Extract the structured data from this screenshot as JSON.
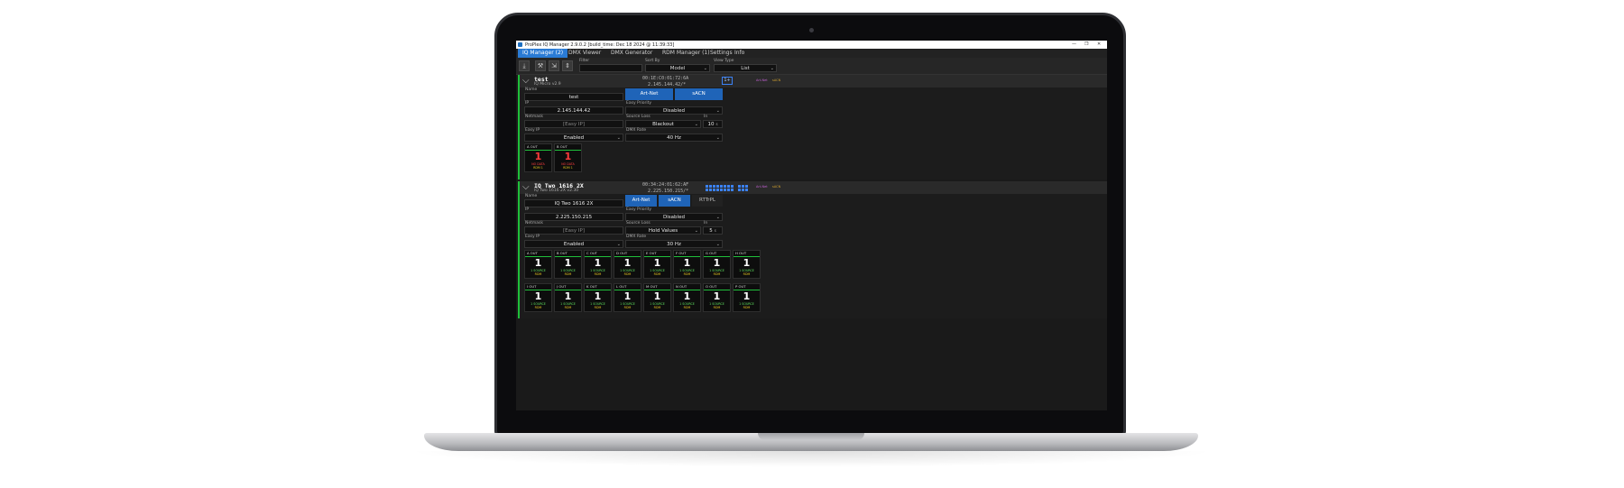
{
  "window": {
    "title": "ProPlex IQ Manager 2.9.0.2 [build_time: Dec 18 2024 @ 11:39:33]",
    "minimize": "—",
    "maximize": "❐",
    "close": "✕"
  },
  "menu": {
    "items": [
      "IQ Manager (2)",
      "DMX Viewer",
      "DMX Generator",
      "RDM Manager (1)",
      "Settings",
      "Info"
    ],
    "active_index": 0
  },
  "toolbar": {
    "icons": [
      "download-icon",
      "wrench-icon",
      "collapse-icon",
      "expand-icon"
    ],
    "filter": {
      "label": "Filter",
      "value": ""
    },
    "sort_by": {
      "label": "Sort By",
      "value": "Model"
    },
    "view_type": {
      "label": "View Type",
      "value": "List"
    }
  },
  "devices": [
    {
      "name": "test",
      "subtitle": "IQ Micro v2.9",
      "mac": "00:1E:C0:01:72:6A",
      "ip_display": "2.145.144.42/*",
      "badge": "1+",
      "proto_tags": [
        "Art-Net",
        "sACN"
      ],
      "fields": {
        "name": {
          "label": "Name",
          "value": "test"
        },
        "ip": {
          "label": "IP",
          "value": "2.145.144.42"
        },
        "netmask": {
          "label": "Netmask",
          "value": "[Easy IP]"
        },
        "easy_ip": {
          "label": "Easy IP",
          "value": "Enabled"
        },
        "easy_priority": {
          "label": "Easy Priority",
          "value": "Disabled"
        },
        "source_loss": {
          "label": "Source Loss",
          "value": "Blackout"
        },
        "in": {
          "label": "In",
          "value": "10",
          "unit": "s"
        },
        "dmx_rate": {
          "label": "DMX Rate",
          "value": "40 Hz"
        }
      },
      "protocols": [
        "Art-Net",
        "sACN"
      ],
      "ports": [
        {
          "head": "A   OUT",
          "num": "1",
          "status": "NO DATA",
          "rdm": "RDM  1",
          "alarm": true
        },
        {
          "head": "B   OUT",
          "num": "1",
          "status": "NO DATA",
          "rdm": "RDM  1",
          "alarm": true
        }
      ]
    },
    {
      "name": "IQ Two 1616 2X",
      "subtitle": "IQ Two 1616 2X v2.30",
      "mac": "00:34:24:01:62:AF",
      "ip_display": "2.225.150.215/*",
      "proto_tags": [
        "Art-Net",
        "sACN"
      ],
      "fields": {
        "name": {
          "label": "Name",
          "value": "IQ Two 1616 2X"
        },
        "ip": {
          "label": "IP",
          "value": "2.225.150.215"
        },
        "netmask": {
          "label": "Netmask",
          "value": "[Easy IP]"
        },
        "easy_ip": {
          "label": "Easy IP",
          "value": "Enabled"
        },
        "easy_priority": {
          "label": "Easy Priority",
          "value": "Disabled"
        },
        "source_loss": {
          "label": "Source Loss",
          "value": "Hold Values"
        },
        "in": {
          "label": "In",
          "value": "5",
          "unit": "s"
        },
        "dmx_rate": {
          "label": "DMX Rate",
          "value": "30 Hz"
        }
      },
      "protocols": [
        "Art-Net",
        "sACN",
        "RTTrPL"
      ],
      "ports": [
        {
          "head": "A   OUT",
          "num": "1",
          "status": "1  SOURCE",
          "rdm": "RDM"
        },
        {
          "head": "B   OUT",
          "num": "1",
          "status": "1  SOURCE",
          "rdm": "RDM"
        },
        {
          "head": "C   OUT",
          "num": "1",
          "status": "1  SOURCE",
          "rdm": "RDM"
        },
        {
          "head": "D   OUT",
          "num": "1",
          "status": "1  SOURCE",
          "rdm": "RDM"
        },
        {
          "head": "E   OUT",
          "num": "1",
          "status": "1  SOURCE",
          "rdm": "RDM"
        },
        {
          "head": "F   OUT",
          "num": "1",
          "status": "1  SOURCE",
          "rdm": "RDM"
        },
        {
          "head": "G   OUT",
          "num": "1",
          "status": "1  SOURCE",
          "rdm": "RDM"
        },
        {
          "head": "H   OUT",
          "num": "1",
          "status": "1  SOURCE",
          "rdm": "RDM"
        },
        {
          "head": "I   OUT",
          "num": "1",
          "status": "1  SOURCE",
          "rdm": "RDM"
        },
        {
          "head": "J   OUT",
          "num": "1",
          "status": "1  SOURCE",
          "rdm": "RDM"
        },
        {
          "head": "K   OUT",
          "num": "1",
          "status": "1  SOURCE",
          "rdm": "RDM"
        },
        {
          "head": "L   OUT",
          "num": "1",
          "status": "1  SOURCE",
          "rdm": "RDM"
        },
        {
          "head": "M   OUT",
          "num": "1",
          "status": "1  SOURCE",
          "rdm": "RDM"
        },
        {
          "head": "N   OUT",
          "num": "1",
          "status": "1  SOURCE",
          "rdm": "RDM"
        },
        {
          "head": "O   OUT",
          "num": "1",
          "status": "1  SOURCE",
          "rdm": "RDM"
        },
        {
          "head": "P   OUT",
          "num": "1",
          "status": "1  SOURCE",
          "rdm": "RDM"
        }
      ]
    }
  ],
  "colors": {
    "accent": "#1f64b8",
    "active_green": "#1fbf3a",
    "alarm_red": "#ff3b3b",
    "rdm_yellow": "#e0c020",
    "background": "#1a1a1a"
  }
}
